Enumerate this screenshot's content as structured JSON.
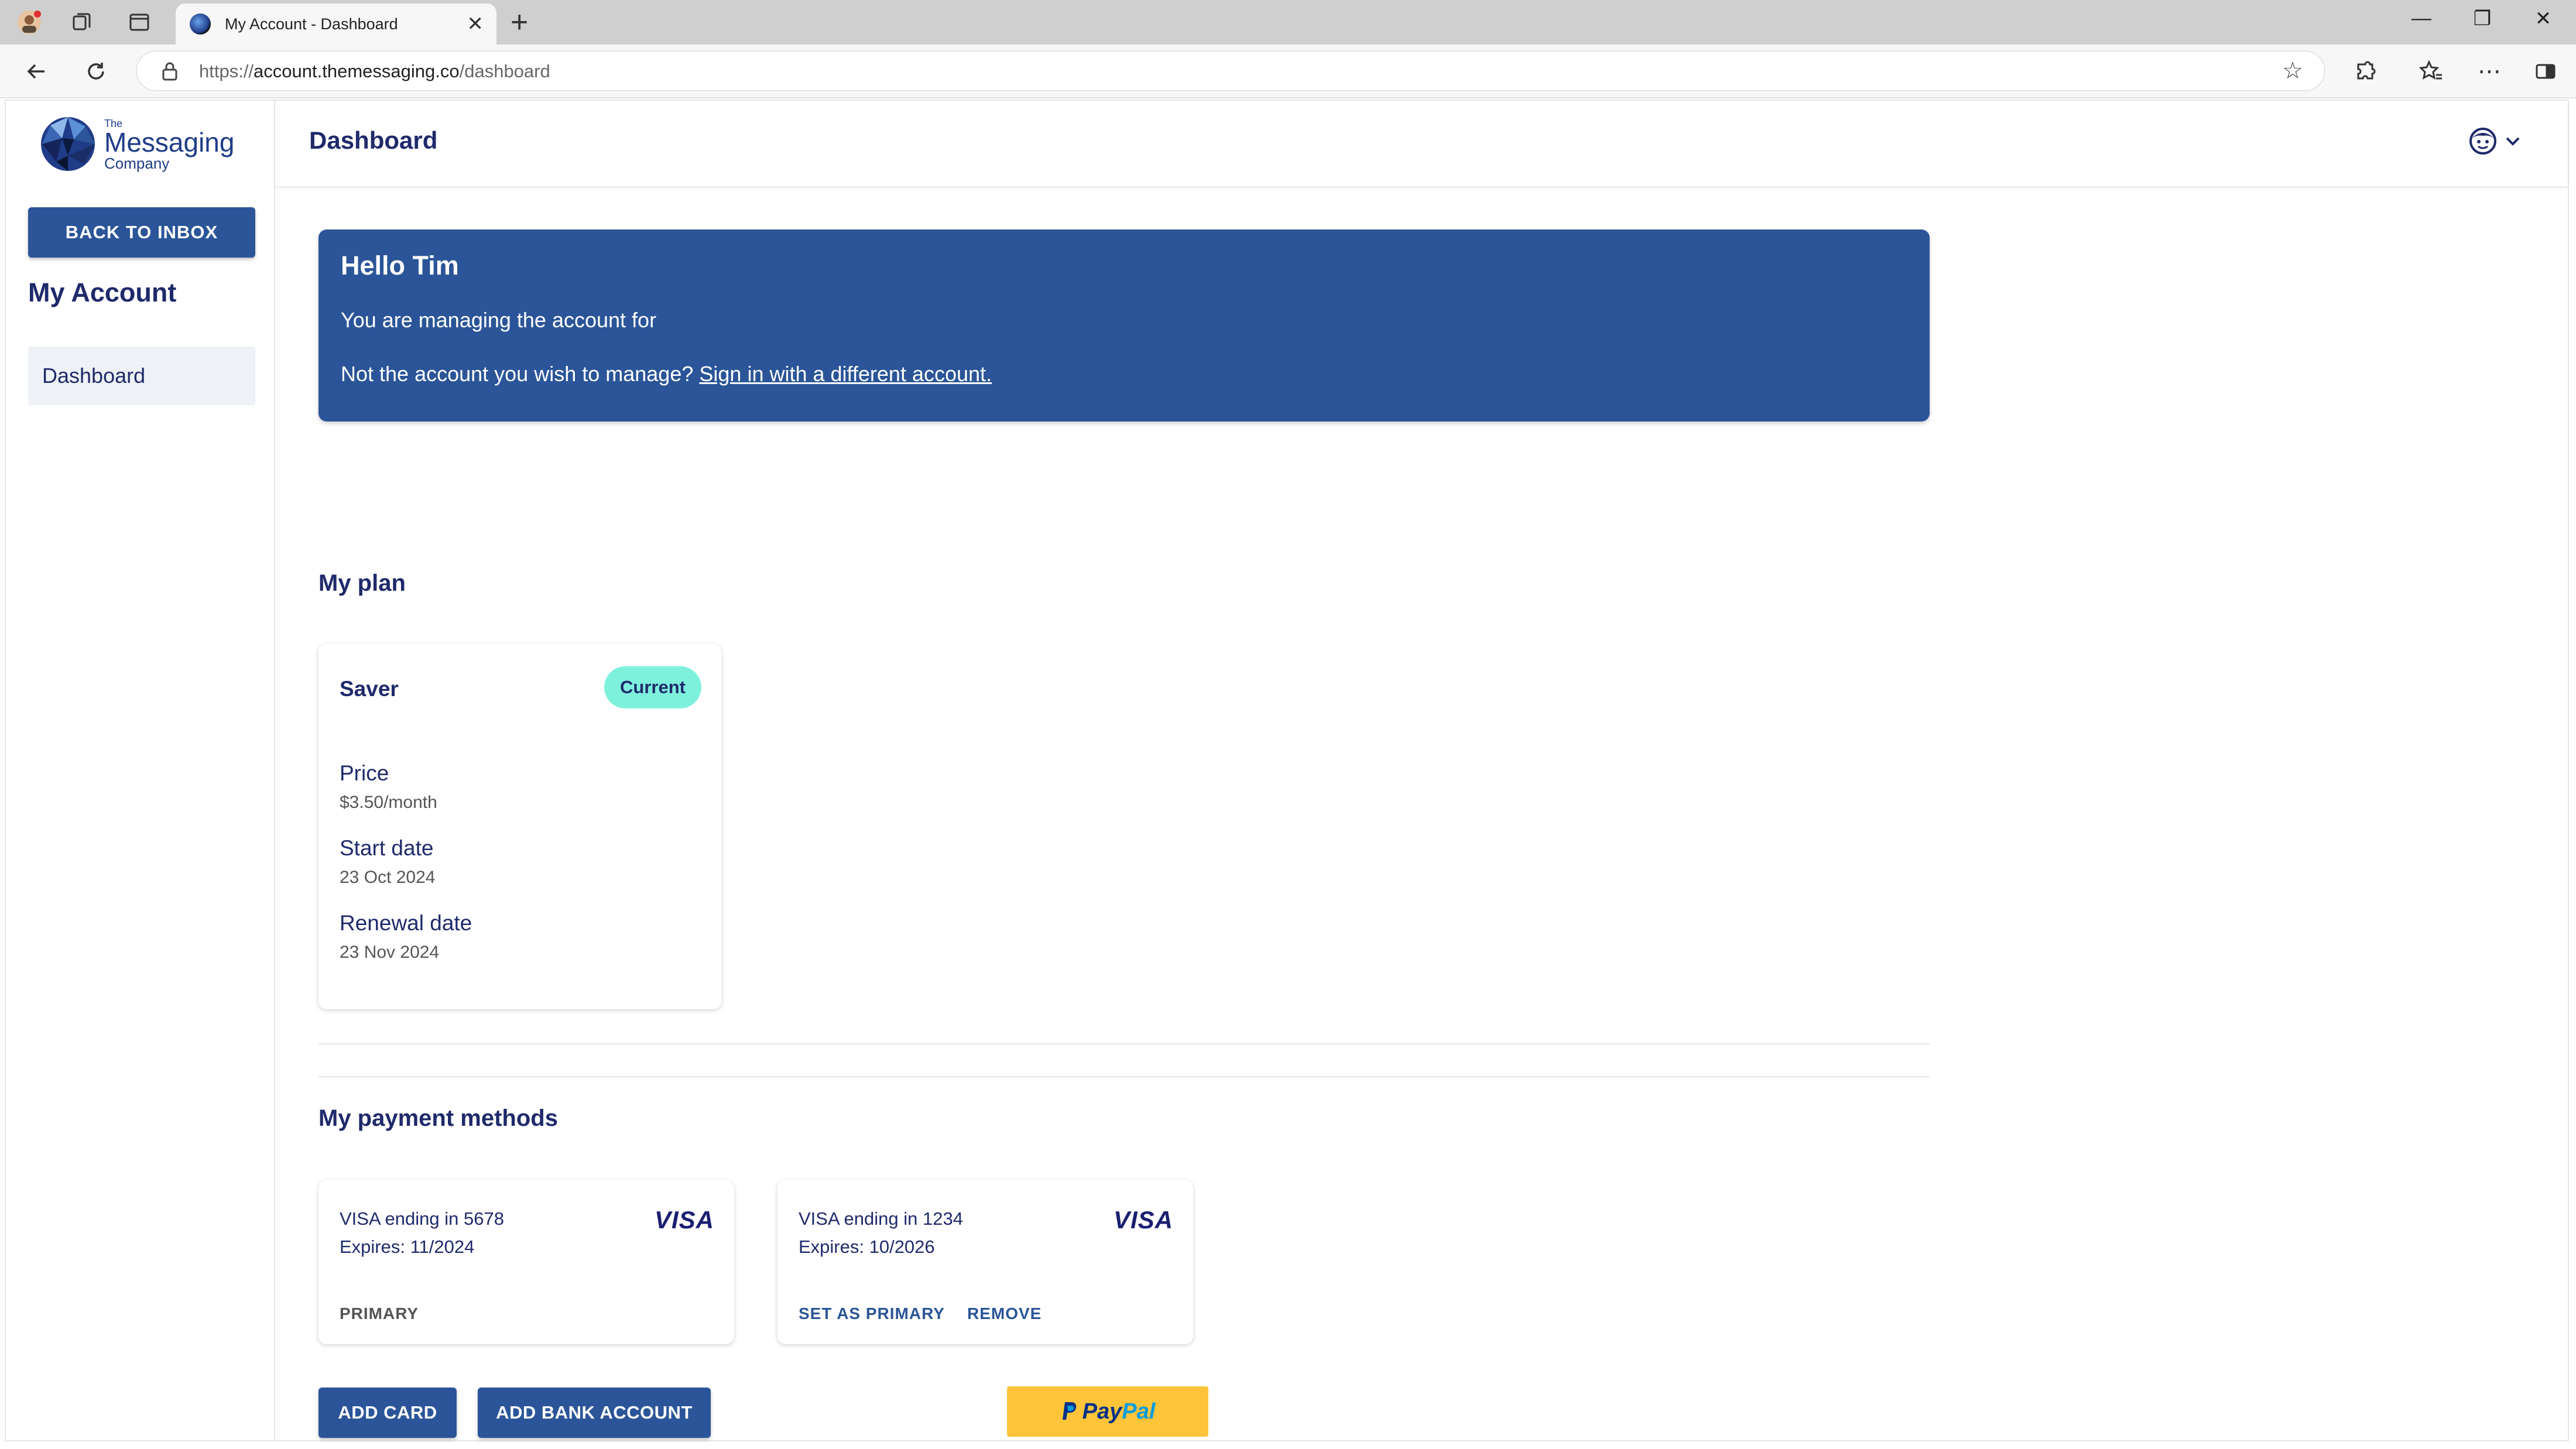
{
  "browser": {
    "tab_title": "My Account - Dashboard",
    "url_scheme": "https://",
    "url_host": "account.themessaging.co",
    "url_path": "/dashboard"
  },
  "sidebar": {
    "logo": {
      "small": "The",
      "big": "Messaging",
      "med": "Company"
    },
    "back_label": "BACK TO INBOX",
    "heading": "My Account",
    "items": [
      {
        "label": "Dashboard"
      }
    ]
  },
  "header": {
    "title": "Dashboard"
  },
  "hello": {
    "title": "Hello Tim",
    "managing": "You are managing the account for",
    "not_account": "Not the account you wish to manage?",
    "sign_in_link": "Sign in with a different account."
  },
  "plan": {
    "section_title": "My plan",
    "name": "Saver",
    "badge": "Current",
    "price_label": "Price",
    "price_value": "$3.50/month",
    "start_label": "Start date",
    "start_value": "23 Oct 2024",
    "renewal_label": "Renewal date",
    "renewal_value": "23 Nov 2024"
  },
  "payments": {
    "section_title": "My payment methods",
    "cards": [
      {
        "line1": "VISA ending in 5678",
        "line2": "Expires: 11/2024",
        "brand": "VISA",
        "status": "PRIMARY"
      },
      {
        "line1": "VISA ending in 1234",
        "line2": "Expires: 10/2026",
        "brand": "VISA",
        "set_primary": "SET AS PRIMARY",
        "remove": "REMOVE"
      }
    ],
    "add_card": "ADD CARD",
    "add_bank": "ADD BANK ACCOUNT",
    "paypal_1": "Pay",
    "paypal_2": "Pal"
  },
  "colors": {
    "brand_blue": "#2b5598",
    "badge_teal": "#7ef1dd",
    "paypal_yellow": "#ffc43a"
  }
}
